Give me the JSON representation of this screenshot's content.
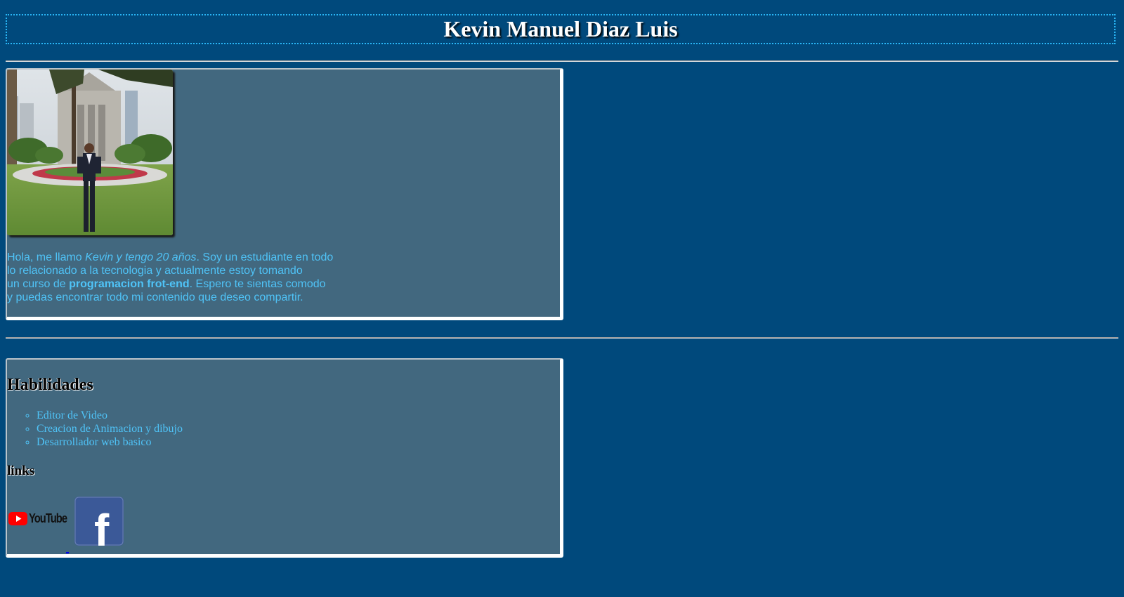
{
  "header": {
    "title": "Kevin Manuel Diaz Luis"
  },
  "about": {
    "photo_alt": "Foto de Kevin",
    "bio": [
      {
        "text": "Hola, me llamo ",
        "style": "normal"
      },
      {
        "text": "Kevin y tengo 20 años",
        "style": "italic"
      },
      {
        "text": ". Soy un estudiante en todo",
        "style": "normal"
      },
      {
        "text": "\n",
        "style": "break"
      },
      {
        "text": "lo relacionado a la tecnologia y actualmente estoy tomando",
        "style": "normal"
      },
      {
        "text": "\n",
        "style": "break"
      },
      {
        "text": "un curso de ",
        "style": "normal"
      },
      {
        "text": "programacion frot-end",
        "style": "bold"
      },
      {
        "text": ". Espero te sientas comodo",
        "style": "normal"
      },
      {
        "text": "\n",
        "style": "break"
      },
      {
        "text": "y puedas encontrar todo mi contenido que deseo compartir.",
        "style": "normal"
      }
    ]
  },
  "skills": {
    "heading": "Habilidades",
    "items": [
      "Editor de Video",
      "Creacion de Animacion y dibujo",
      "Desarrollador web basico"
    ]
  },
  "links": {
    "heading": "links",
    "youtube_label": "YouTube",
    "facebook_letter": "f"
  },
  "colors": {
    "page_background": "#00497c",
    "card_background": "#42687f",
    "accent_text": "#4fc3f7",
    "header_border": "#29b6f6",
    "youtube_red": "#ff0000",
    "facebook_blue": "#3b5998"
  }
}
